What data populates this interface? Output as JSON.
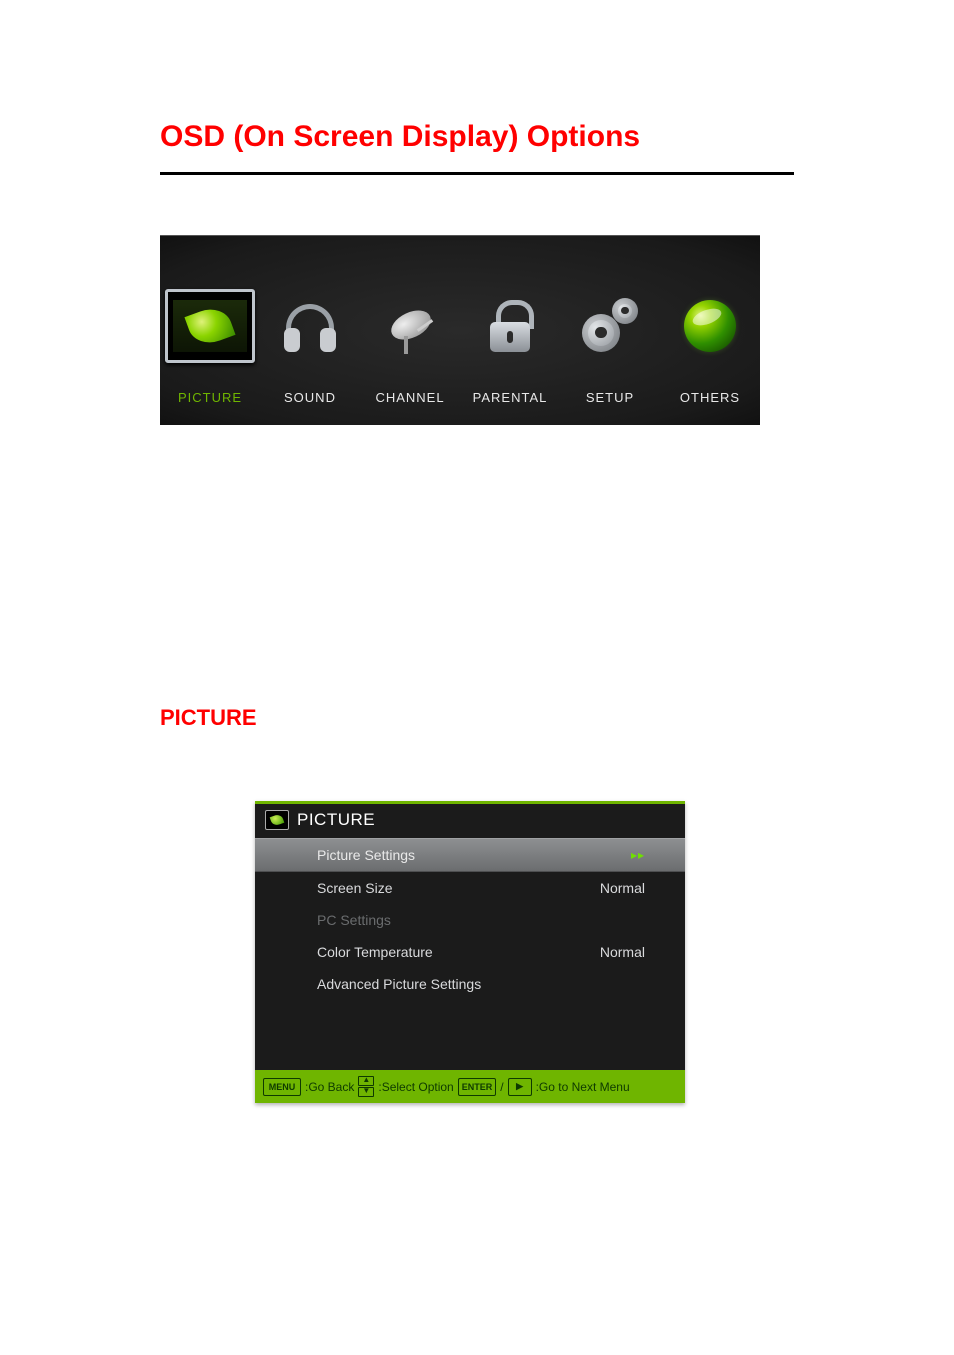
{
  "page": {
    "title": "OSD (On Screen Display) Options",
    "section_heading": "PICTURE"
  },
  "osd_tabs": {
    "picture": "PICTURE",
    "sound": "SOUND",
    "channel": "CHANNEL",
    "parental": "PARENTAL",
    "setup": "SETUP",
    "others": "OTHERS"
  },
  "submenu": {
    "title": "PICTURE",
    "rows": {
      "picture_settings": {
        "label": "Picture Settings",
        "value": "▸▸"
      },
      "screen_size": {
        "label": "Screen Size",
        "value": "Normal"
      },
      "pc_settings": {
        "label": "PC Settings",
        "value": ""
      },
      "color_temp": {
        "label": "Color Temperature",
        "value": "Normal"
      },
      "advanced": {
        "label": "Advanced Picture Settings",
        "value": ""
      }
    },
    "footer": {
      "menu_key": "MENU",
      "go_back": ":Go Back",
      "select": ":Select Option",
      "enter_key": "ENTER",
      "next": ":Go to Next Menu"
    }
  }
}
